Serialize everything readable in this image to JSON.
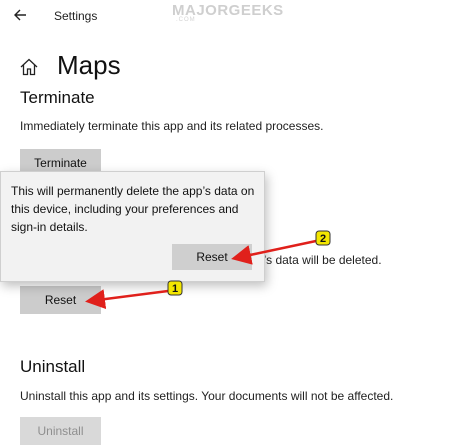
{
  "titlebar": {
    "title": "Settings"
  },
  "watermark": {
    "text": "MAJORGEEKS",
    "subtext": ".COM"
  },
  "page": {
    "title": "Maps"
  },
  "terminate": {
    "heading": "Terminate",
    "description": "Immediately terminate this app and its related processes.",
    "button_label": "Terminate"
  },
  "reset": {
    "partial_description": "p’s data will be deleted.",
    "button_label": "Reset"
  },
  "flyout": {
    "message": "This will permanently delete the app’s data on this device, including your preferences and sign-in details.",
    "button_label": "Reset"
  },
  "callouts": [
    {
      "number": "1"
    },
    {
      "number": "2"
    }
  ],
  "uninstall": {
    "heading": "Uninstall",
    "description": "Uninstall this app and its settings. Your documents will not be affected.",
    "button_label": "Uninstall"
  },
  "colors": {
    "arrow": "#e0201b",
    "callout_fill": "#f3e600",
    "button_bg": "#cccccc"
  }
}
